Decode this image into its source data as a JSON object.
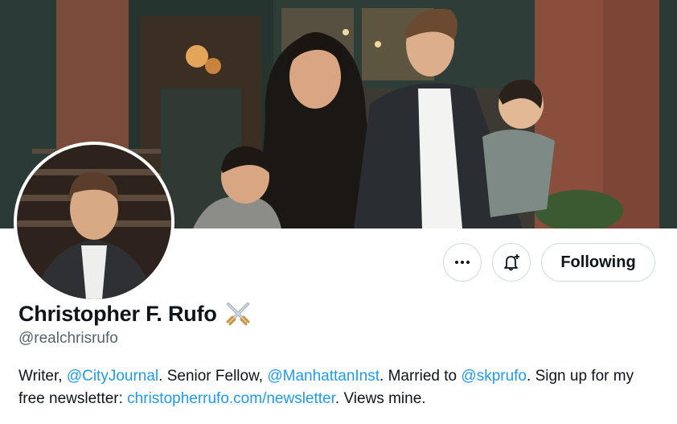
{
  "profile": {
    "name": "Christopher F. Rufo",
    "name_emoji": "crossed-swords-emoji",
    "handle": "@realchrisrufo"
  },
  "actions": {
    "more_icon": "more-dots-icon",
    "notify_icon": "bell-plus-icon",
    "following_label": "Following"
  },
  "bio": {
    "t1": "Writer, ",
    "m1": "@CityJournal",
    "t2": ". Senior Fellow, ",
    "m2": "@ManhattanInst",
    "t3": ". Married to ",
    "m3": "@skprufo",
    "t4": ". Sign up for my free newsletter: ",
    "link": "christopherrufo.com/newsletter",
    "t5": ". Views mine."
  },
  "colors": {
    "link": "#1d9bf0",
    "text": "#0f1419",
    "secondary": "#536471",
    "border": "#cfd9de"
  }
}
